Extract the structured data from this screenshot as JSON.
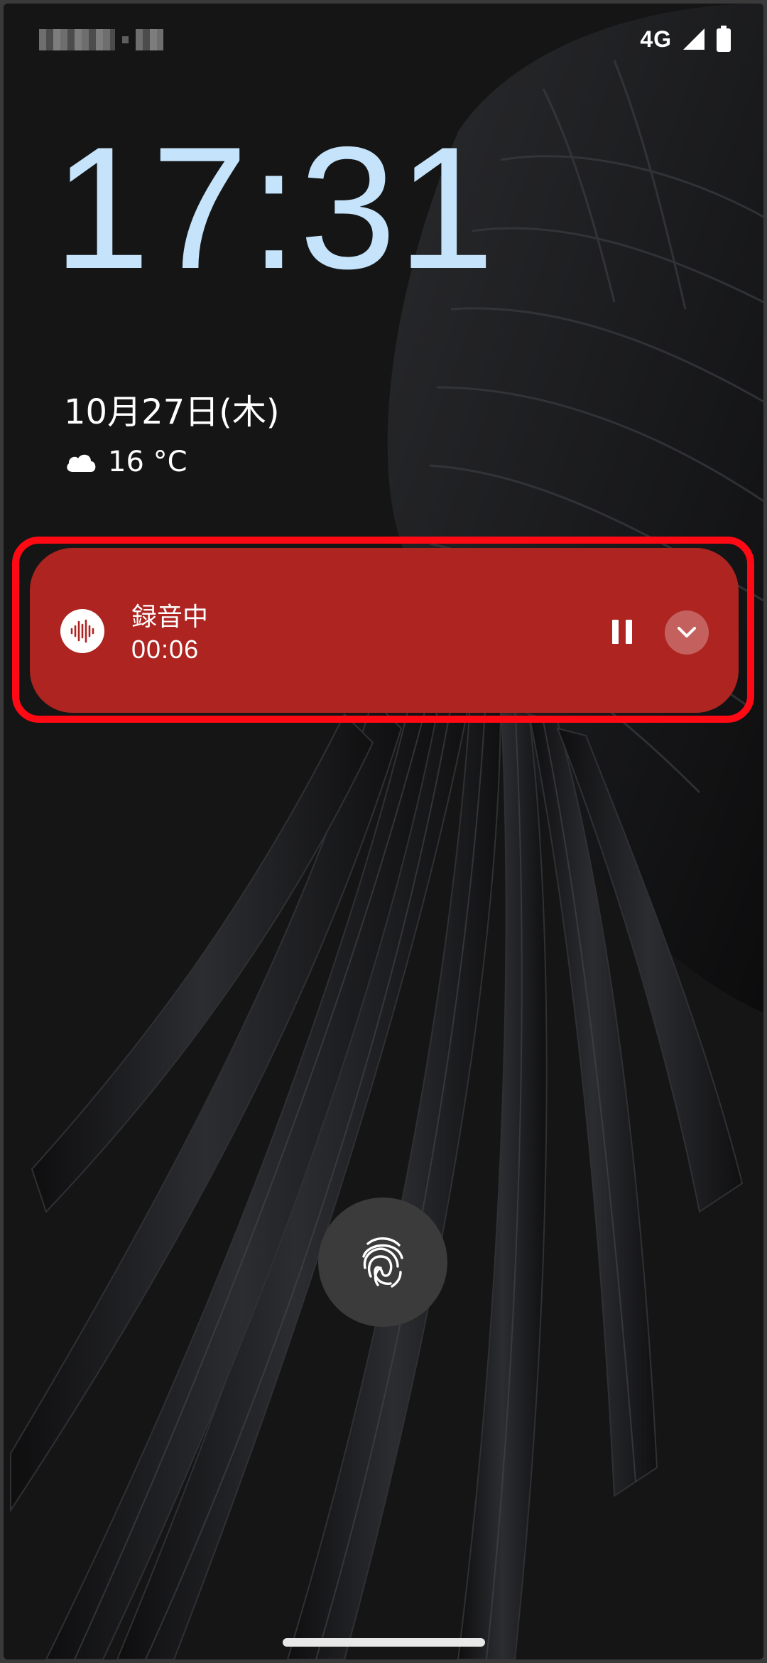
{
  "status_bar": {
    "network_type": "4G",
    "signal_icon": "cell-signal-icon",
    "battery_icon": "battery-icon"
  },
  "lock_screen": {
    "time": "17:31",
    "date": "10月27日(木)",
    "weather": {
      "icon": "cloud-icon",
      "temperature": "16 °C"
    }
  },
  "notification": {
    "app_icon": "waveform-icon",
    "title": "録音中",
    "elapsed": "00:06",
    "actions": {
      "pause_icon": "pause-icon",
      "expand_icon": "chevron-down-icon"
    },
    "colors": {
      "card": "#ad2420",
      "highlight": "#ff0a14"
    }
  },
  "fingerprint": {
    "icon": "fingerprint-icon"
  },
  "colors": {
    "clock": "#c5e4fb",
    "background": "#151515"
  }
}
